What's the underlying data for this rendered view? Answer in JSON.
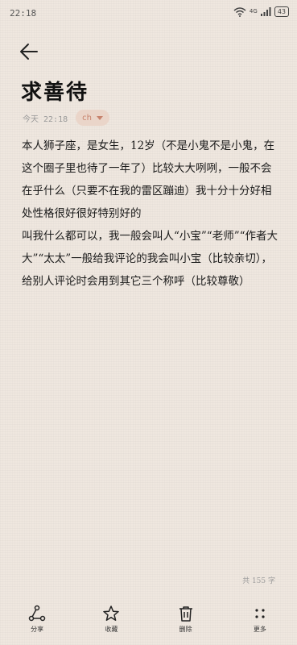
{
  "status": {
    "time": "22:18",
    "network": "4G",
    "battery": "43"
  },
  "note": {
    "title": "求善待",
    "date": "今天 22:18",
    "tag": "ch",
    "paragraphs": [
      "本人狮子座，是女生，12岁（不是小鬼不是小鬼，在这个圈子里也待了一年了）比较大大咧咧，一般不会在乎什么（只要不在我的雷区蹦迪）我十分十分好相处性格很好很好特别好的",
      "叫我什么都可以，我一般会叫人“小宝”“老师”“作者大大”“太太”一般给我评论的我会叫小宝（比较亲切），给别人评论时会用到其它三个称呼（比较尊敬）"
    ],
    "word_count": "共 155 字"
  },
  "toolbar": {
    "share": "分享",
    "favorite": "收藏",
    "delete": "删除",
    "more": "更多"
  }
}
